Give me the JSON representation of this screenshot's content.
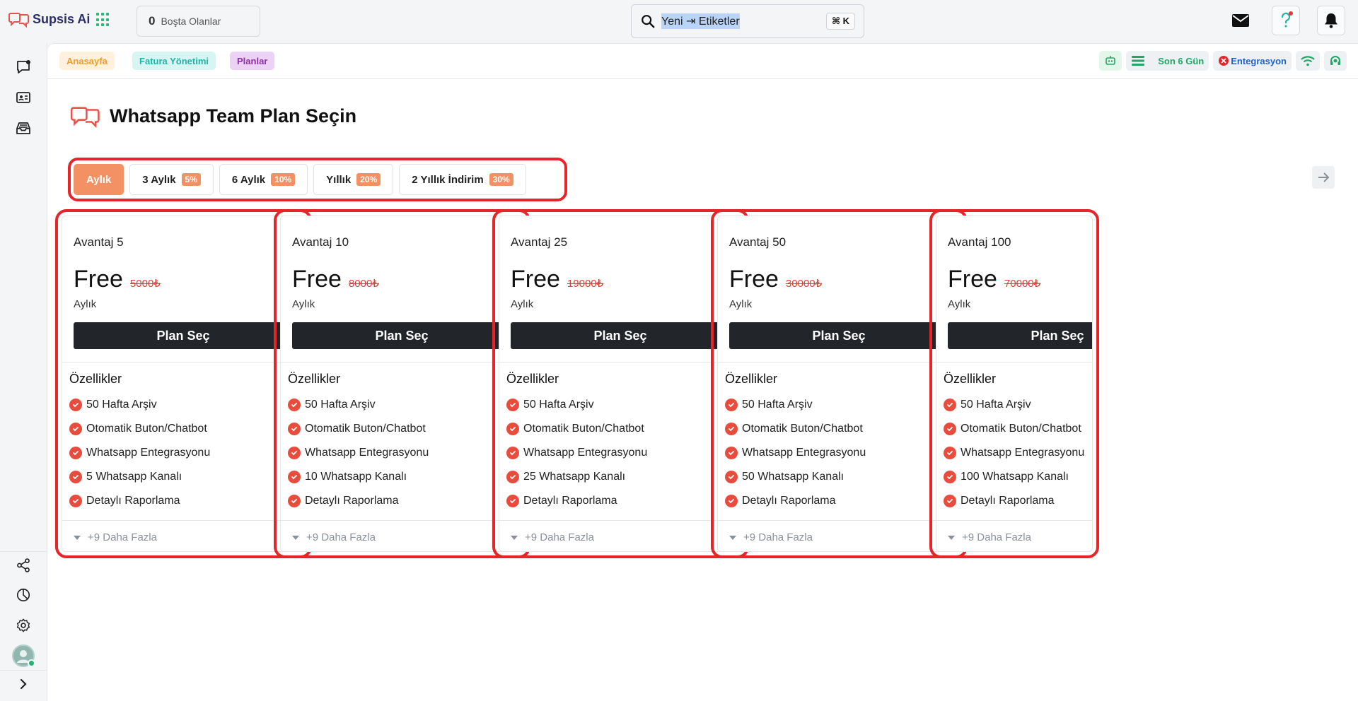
{
  "app": {
    "name": "Supsis Ai",
    "idle": {
      "count": "0",
      "label": "Boşta Olanlar"
    },
    "search": {
      "text": "Yeni ⇥ Etiketler",
      "shortcut": "⌘ K"
    }
  },
  "breadcrumbs": [
    "Anasayfa",
    "Fatura Yönetimi",
    "Planlar"
  ],
  "status": {
    "days": "Son 6 Gün",
    "integration": "Entegrasyon"
  },
  "page": {
    "title": "Whatsapp Team Plan Seçin"
  },
  "tabs": [
    {
      "label": "Aylık",
      "badge": ""
    },
    {
      "label": "3 Aylık",
      "badge": "5%"
    },
    {
      "label": "6 Aylık",
      "badge": "10%"
    },
    {
      "label": "Yıllık",
      "badge": "20%"
    },
    {
      "label": "2 Yıllık İndirim",
      "badge": "30%"
    }
  ],
  "plans": [
    {
      "name": "Avantaj 5",
      "price": "Free",
      "old_price": "5000₺",
      "period": "Aylık",
      "button": "Plan Seç",
      "features_title": "Özellikler",
      "features": [
        "50 Hafta Arşiv",
        "Otomatik Buton/Chatbot",
        "Whatsapp Entegrasyonu",
        "5 Whatsapp Kanalı",
        "Detaylı Raporlama"
      ],
      "more": "+9 Daha Fazla"
    },
    {
      "name": "Avantaj 10",
      "price": "Free",
      "old_price": "8000₺",
      "period": "Aylık",
      "button": "Plan Seç",
      "features_title": "Özellikler",
      "features": [
        "50 Hafta Arşiv",
        "Otomatik Buton/Chatbot",
        "Whatsapp Entegrasyonu",
        "10 Whatsapp Kanalı",
        "Detaylı Raporlama"
      ],
      "more": "+9 Daha Fazla"
    },
    {
      "name": "Avantaj 25",
      "price": "Free",
      "old_price": "19000₺",
      "period": "Aylık",
      "button": "Plan Seç",
      "features_title": "Özellikler",
      "features": [
        "50 Hafta Arşiv",
        "Otomatik Buton/Chatbot",
        "Whatsapp Entegrasyonu",
        "25 Whatsapp Kanalı",
        "Detaylı Raporlama"
      ],
      "more": "+9 Daha Fazla"
    },
    {
      "name": "Avantaj 50",
      "price": "Free",
      "old_price": "30000₺",
      "period": "Aylık",
      "button": "Plan Seç",
      "features_title": "Özellikler",
      "features": [
        "50 Hafta Arşiv",
        "Otomatik Buton/Chatbot",
        "Whatsapp Entegrasyonu",
        "50 Whatsapp Kanalı",
        "Detaylı Raporlama"
      ],
      "more": "+9 Daha Fazla"
    },
    {
      "name": "Avantaj 100",
      "price": "Free",
      "old_price": "70000₺",
      "period": "Aylık",
      "button": "Plan Seç",
      "features_title": "Özellikler",
      "features": [
        "50 Hafta Arşiv",
        "Otomatik Buton/Chatbot",
        "Whatsapp Entegrasyonu",
        "100 Whatsapp Kanalı",
        "Detaylı Raporlama"
      ],
      "more": "+9 Daha Fazla"
    }
  ],
  "colors": {
    "accent": "#f49164",
    "highlight": "#e5252a",
    "button": "#22262b",
    "check": "#e94b3c"
  }
}
